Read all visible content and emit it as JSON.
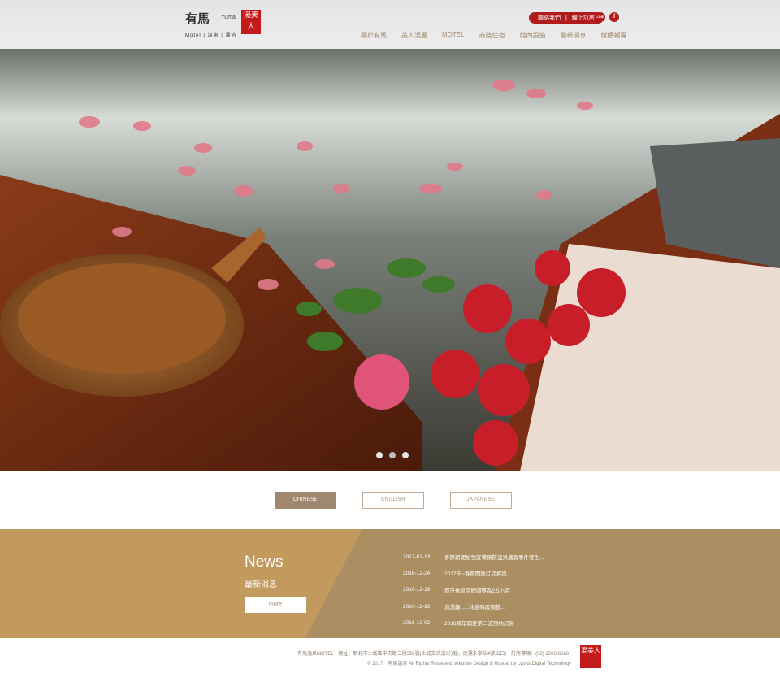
{
  "header": {
    "logo": {
      "mark": "有馬",
      "brand_en": "Yuma",
      "sub": "Motel | 溫泉 | 湯浴",
      "stamp": "湯美人"
    },
    "top_actions": {
      "contact_label": "聯絡我們",
      "separator": "|",
      "booking_label": "線上訂房"
    },
    "social": [
      {
        "icon": "line-icon",
        "glyph": "LINE"
      },
      {
        "icon": "facebook-icon",
        "glyph": "f"
      }
    ],
    "nav": [
      {
        "label": "關於有馬"
      },
      {
        "label": "美人湯屋"
      },
      {
        "label": "MOTEL"
      },
      {
        "label": "商務住宿"
      },
      {
        "label": "館內設施"
      },
      {
        "label": "最新消息"
      },
      {
        "label": "媒體報導"
      }
    ]
  },
  "hero": {
    "slide_count": 3,
    "active_slide": 2
  },
  "languages": [
    {
      "label": "CHINESE",
      "active": true
    },
    {
      "label": "ENGLISH",
      "active": false
    },
    {
      "label": "JAPANESE",
      "active": false
    }
  ],
  "news": {
    "title": "News",
    "subtitle": "最新消息",
    "more_label": "more",
    "items": [
      {
        "date": "2017-01-13",
        "text": "春節期間加強宣導預防溫泉蟲害事件發生..."
      },
      {
        "date": "2016-12-24",
        "text": "2017年~春節開放訂房資訊"
      },
      {
        "date": "2016-12-19",
        "text": "假日休息時間調整為2.5小時"
      },
      {
        "date": "2016-12-19",
        "text": "泡湯趣......休息時段調整..."
      },
      {
        "date": "2016-12-02",
        "text": "2016跨年國定第二波預約訂房"
      }
    ]
  },
  "footer": {
    "line1": "有馬溫泉MOTEL　地址：新北市土城區中央路二段392號(土城交流道3分鐘，捷運永寧站4號出口)　訂房專線：(02) 2260-6666",
    "line2": "© 2017　有馬溫泉 All Rights Reserved. Website Design & Hosted by Lyons Digital Technology",
    "stamp": "湯美人"
  },
  "colors": {
    "accent_red": "#b01c1c",
    "tan": "#a08870",
    "news_bg": "#ab8e61"
  }
}
